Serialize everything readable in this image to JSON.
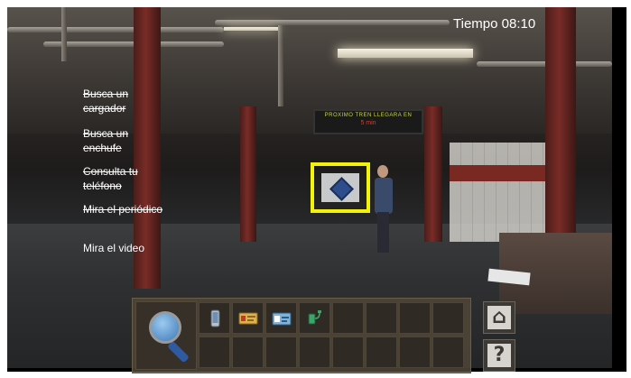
{
  "hud": {
    "timer": "Tiempo 08:10"
  },
  "tasks": [
    {
      "line1": "Busca un",
      "line2": "cargador",
      "done": true
    },
    {
      "line1": "Busca un",
      "line2": "enchufe",
      "done": true
    },
    {
      "line1": "Consulta tu",
      "line2": "teléfono",
      "done": true
    },
    {
      "line1": "Mira el periódico",
      "line2": "",
      "done": true
    },
    {
      "line1": "Mira el video",
      "line2": "",
      "done": false
    }
  ],
  "sign": {
    "line1": "PROXIMO TREN LLEGARA EN",
    "line2": "5 min"
  },
  "inventory": {
    "tool": "magnifier-icon",
    "items": [
      "phone-icon",
      "id-card-icon",
      "ticket-icon",
      "charger-icon"
    ]
  },
  "buttons": {
    "home": "home-icon",
    "help": "?"
  },
  "colors": {
    "highlight": "#f2f20a",
    "text": "#ffffff"
  }
}
